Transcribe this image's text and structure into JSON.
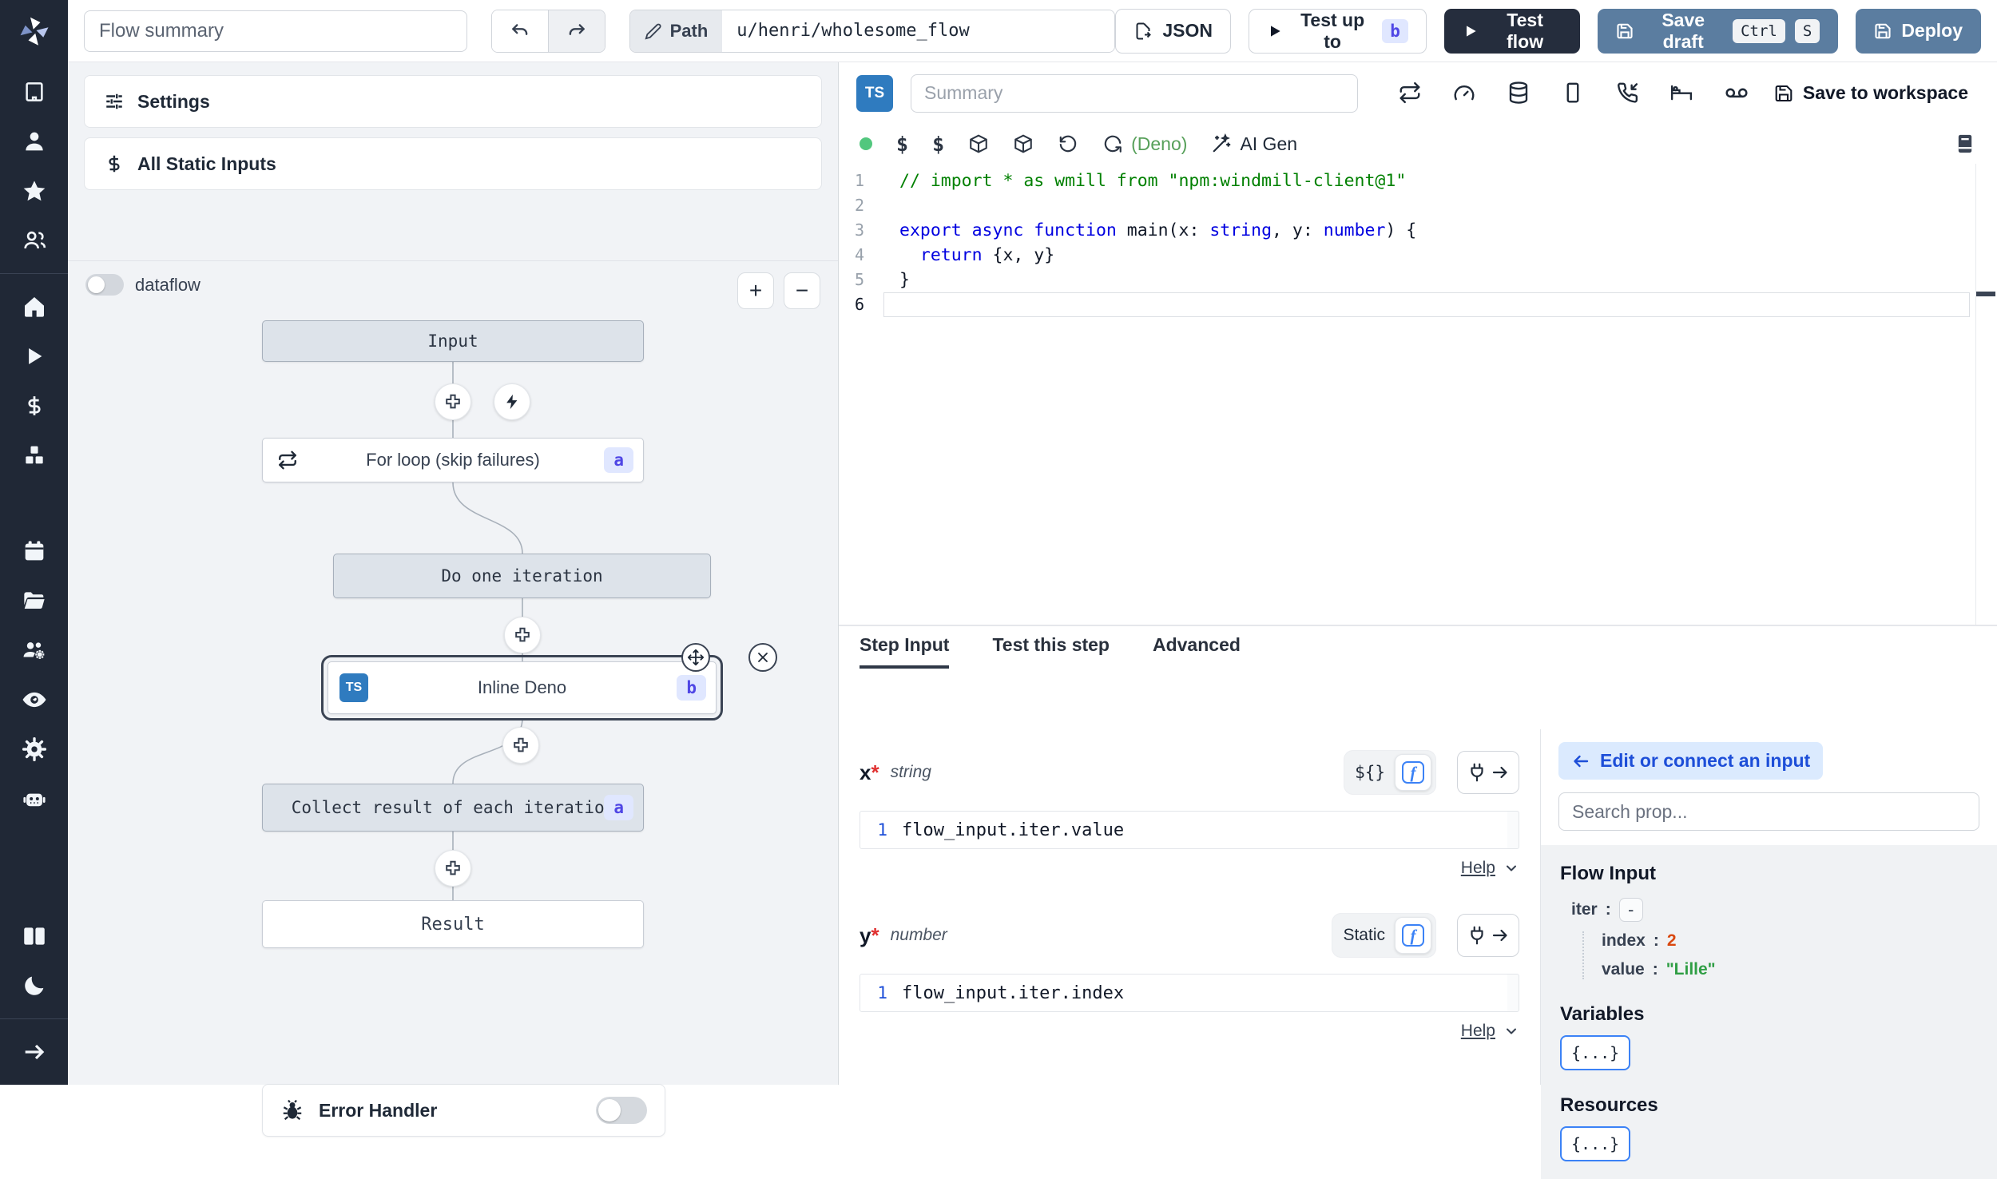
{
  "topbar": {
    "flow_summary_placeholder": "Flow summary",
    "path_label": "Path",
    "path_value": "u/henri/wholesome_flow",
    "json_label": "JSON",
    "test_up_to_label": "Test up to",
    "test_up_to_badge": "b",
    "test_flow_label": "Test flow",
    "save_draft_label": "Save draft",
    "kbd_ctrl": "Ctrl",
    "kbd_s": "S",
    "deploy_label": "Deploy"
  },
  "left_panel": {
    "settings_label": "Settings",
    "static_inputs_label": "All Static Inputs",
    "dataflow_label": "dataflow",
    "zoom_in": "+",
    "zoom_out": "−",
    "error_handler_label": "Error Handler"
  },
  "graph": {
    "input_node": "Input",
    "forloop_node": "For loop (skip failures)",
    "forloop_badge": "a",
    "iteration_node": "Do one iteration",
    "inline_node": "Inline Deno",
    "inline_badge": "b",
    "inline_lang": "TS",
    "collect_node": "Collect result of each iteration",
    "collect_badge": "a",
    "result_node": "Result"
  },
  "editor": {
    "lang_badge": "TS",
    "summary_placeholder": "Summary",
    "save_to_workspace_label": "Save to workspace",
    "dollar_icon_label": "$",
    "runtime_label": "(Deno)",
    "ai_gen_label": "AI Gen",
    "code": {
      "lines": [
        [
          [
            "cmt",
            "// import * as wmill from \"npm:windmill-client@1\""
          ]
        ],
        [],
        [
          [
            "kw",
            "export async function"
          ],
          [
            "pl",
            " main("
          ],
          [
            "pl",
            "x: "
          ],
          [
            "kw",
            "string"
          ],
          [
            "pl",
            ", y: "
          ],
          [
            "kw",
            "number"
          ],
          [
            "pl",
            ") {"
          ]
        ],
        [
          [
            "pl",
            "  "
          ],
          [
            "kw",
            "return"
          ],
          [
            "pl",
            " {x, y}"
          ]
        ],
        [
          [
            "pl",
            "}"
          ]
        ],
        []
      ]
    }
  },
  "step_panel": {
    "tabs": [
      "Step Input",
      "Test this step",
      "Advanced"
    ],
    "fields": [
      {
        "name": "x",
        "star": "*",
        "type": "string",
        "toggle": "${}",
        "line_no": "1",
        "expr": "flow_input.iter.value",
        "help": "Help"
      },
      {
        "name": "y",
        "star": "*",
        "type": "number",
        "toggle": "Static",
        "line_no": "1",
        "expr": "flow_input.iter.index",
        "help": "Help"
      }
    ]
  },
  "props_panel": {
    "edit_connect_label": "Edit or connect an input",
    "search_placeholder": "Search prop...",
    "flow_input_title": "Flow Input",
    "iter_key": "iter",
    "collapse_glyph": "-",
    "index_key": "index",
    "index_value": "2",
    "value_key": "value",
    "value_value": "\"Lille\"",
    "variables_title": "Variables",
    "resources_title": "Resources",
    "object_glyph": "{...}"
  },
  "colors": {
    "accent_blue": "#3b82f6",
    "steel_button": "#5b7da0",
    "dark_button": "#252d3d",
    "sidebar_bg": "#202836",
    "badge_bg": "#e0e7ff",
    "badge_text": "#4f46e5",
    "code_keyword": "#0000e0",
    "code_comment": "#008000",
    "json_number_value": "#d9480f",
    "json_string_value": "#2f9e44",
    "deno_green": "#57a05a",
    "status_dot_green": "#52c77e"
  }
}
